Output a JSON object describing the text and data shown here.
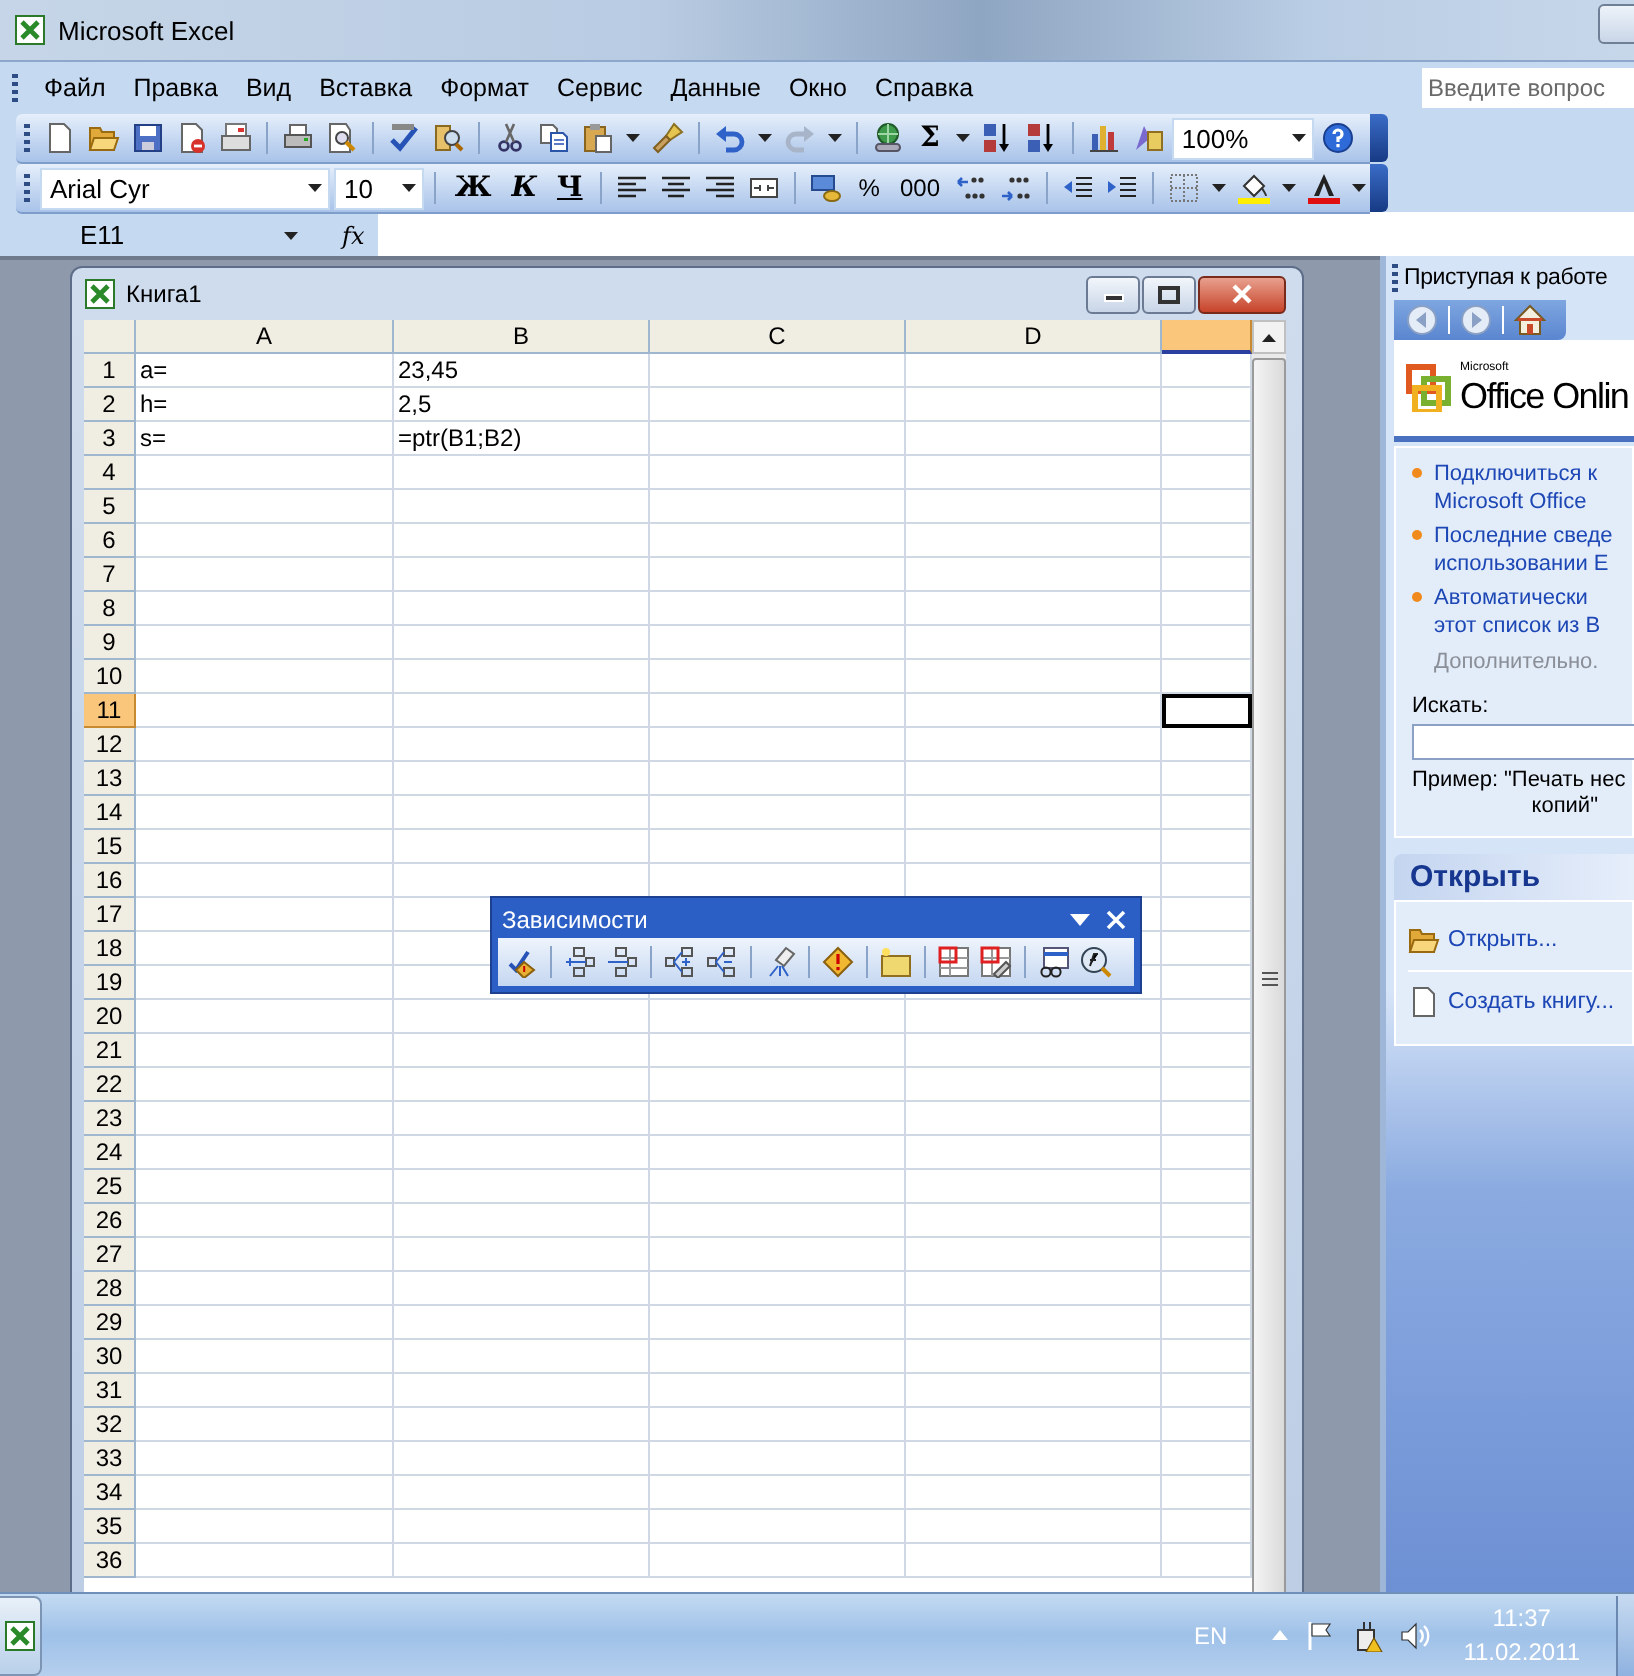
{
  "window": {
    "title": "Microsoft Excel"
  },
  "menu": [
    "Файл",
    "Правка",
    "Вид",
    "Вставка",
    "Формат",
    "Сервис",
    "Данные",
    "Окно",
    "Справка"
  ],
  "help_search": {
    "placeholder": "Введите вопрос"
  },
  "standard_toolbar": {
    "sum": "Σ",
    "zoom": "100%"
  },
  "formatting_toolbar": {
    "font": "Arial Cyr",
    "size": "10",
    "bold": "Ж",
    "italic": "К",
    "underline": "Ч",
    "percent": "%",
    "thousands": "000"
  },
  "formula_bar": {
    "name_box": "E11",
    "fx": "fx"
  },
  "workbook": {
    "title": "Книга1",
    "columns": [
      {
        "label": "A",
        "selected": false
      },
      {
        "label": "B",
        "selected": false
      },
      {
        "label": "C",
        "selected": false
      },
      {
        "label": "D",
        "selected": false
      },
      {
        "selected": true
      }
    ],
    "rows": [
      {
        "header": "1",
        "selected": false,
        "cells": [
          "a=",
          "23,45"
        ]
      },
      {
        "header": "2",
        "selected": false,
        "cells": [
          "h=",
          "2,5"
        ]
      },
      {
        "header": "3",
        "selected": false,
        "cells": [
          "s=",
          "=ptr(B1;B2)"
        ]
      },
      {
        "header": "4",
        "selected": false
      },
      {
        "header": "5",
        "selected": false
      },
      {
        "header": "6",
        "selected": false
      },
      {
        "header": "7",
        "selected": false
      },
      {
        "header": "8",
        "selected": false
      },
      {
        "header": "9",
        "selected": false
      },
      {
        "header": "10",
        "selected": false
      },
      {
        "header": "11",
        "selected": true
      },
      {
        "header": "12",
        "selected": false
      },
      {
        "header": "13",
        "selected": false
      },
      {
        "header": "14",
        "selected": false
      },
      {
        "header": "15",
        "selected": false
      },
      {
        "header": "16",
        "selected": false
      },
      {
        "header": "17",
        "selected": false
      },
      {
        "header": "18",
        "selected": false
      },
      {
        "header": "19",
        "selected": false
      },
      {
        "header": "20",
        "selected": false
      },
      {
        "header": "21",
        "selected": false
      },
      {
        "header": "22",
        "selected": false
      },
      {
        "header": "23",
        "selected": false
      },
      {
        "header": "24",
        "selected": false
      },
      {
        "header": "25",
        "selected": false
      },
      {
        "header": "26",
        "selected": false
      },
      {
        "header": "27",
        "selected": false
      },
      {
        "header": "28",
        "selected": false
      },
      {
        "header": "29",
        "selected": false
      },
      {
        "header": "30",
        "selected": false
      },
      {
        "header": "31",
        "selected": false
      },
      {
        "header": "32",
        "selected": false
      },
      {
        "header": "33",
        "selected": false
      },
      {
        "header": "34",
        "selected": false
      },
      {
        "header": "35",
        "selected": false
      },
      {
        "header": "36",
        "selected": false
      }
    ]
  },
  "dependencies_toolbar": {
    "title": "Зависимости"
  },
  "task_pane": {
    "title": "Приступая к работе",
    "logo_small": "Microsoft",
    "logo": "Office Onlin",
    "links": [
      {
        "lines": [
          "Подключиться к",
          "Microsoft Office"
        ]
      },
      {
        "lines": [
          "Последние сведе",
          "использовании E"
        ]
      },
      {
        "lines": [
          "Автоматически",
          "этот список из В"
        ]
      }
    ],
    "more": "Дополнительно.",
    "search_label": "Искать:",
    "example_label": "Пример:",
    "example_lines": [
      "\"Печать нес",
      "копий\""
    ],
    "section": "Открыть",
    "open_items": [
      "Открыть...",
      "Создать книгу..."
    ]
  },
  "taskbar": {
    "language": "EN",
    "time": "11:37",
    "date": "11.02.2011"
  }
}
